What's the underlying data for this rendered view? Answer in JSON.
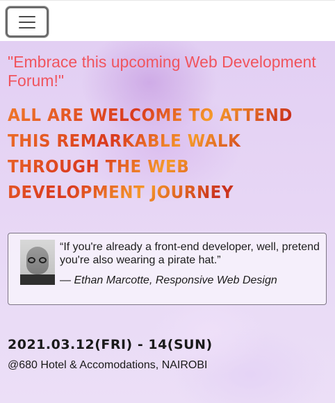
{
  "nav": {
    "menu_icon": "hamburger-menu-icon"
  },
  "hero": {
    "tagline": "\"Embrace this upcoming Web Development Forum!\"",
    "headline": "ALL ARE WELCOME TO ATTEND THIS REMARKABLE WALK THROUGH THE WEB DEVELOPMENT JOURNEY",
    "colors": {
      "tagline": "#f0545e",
      "headline": "#e0572a",
      "background": "#e7d6f5"
    }
  },
  "quote": {
    "avatar_icon": "author-portrait",
    "text": "“If you're already a front-end developer, well, pretend you're also wearing a pirate hat.”",
    "cite_prefix": "— ",
    "author": "Ethan Marcotte, Responsive Web Design"
  },
  "event": {
    "date": "2021.03.12(FRI) - 14(SUN)",
    "venue": "@680 Hotel & Accomodations, NAIROBI"
  }
}
